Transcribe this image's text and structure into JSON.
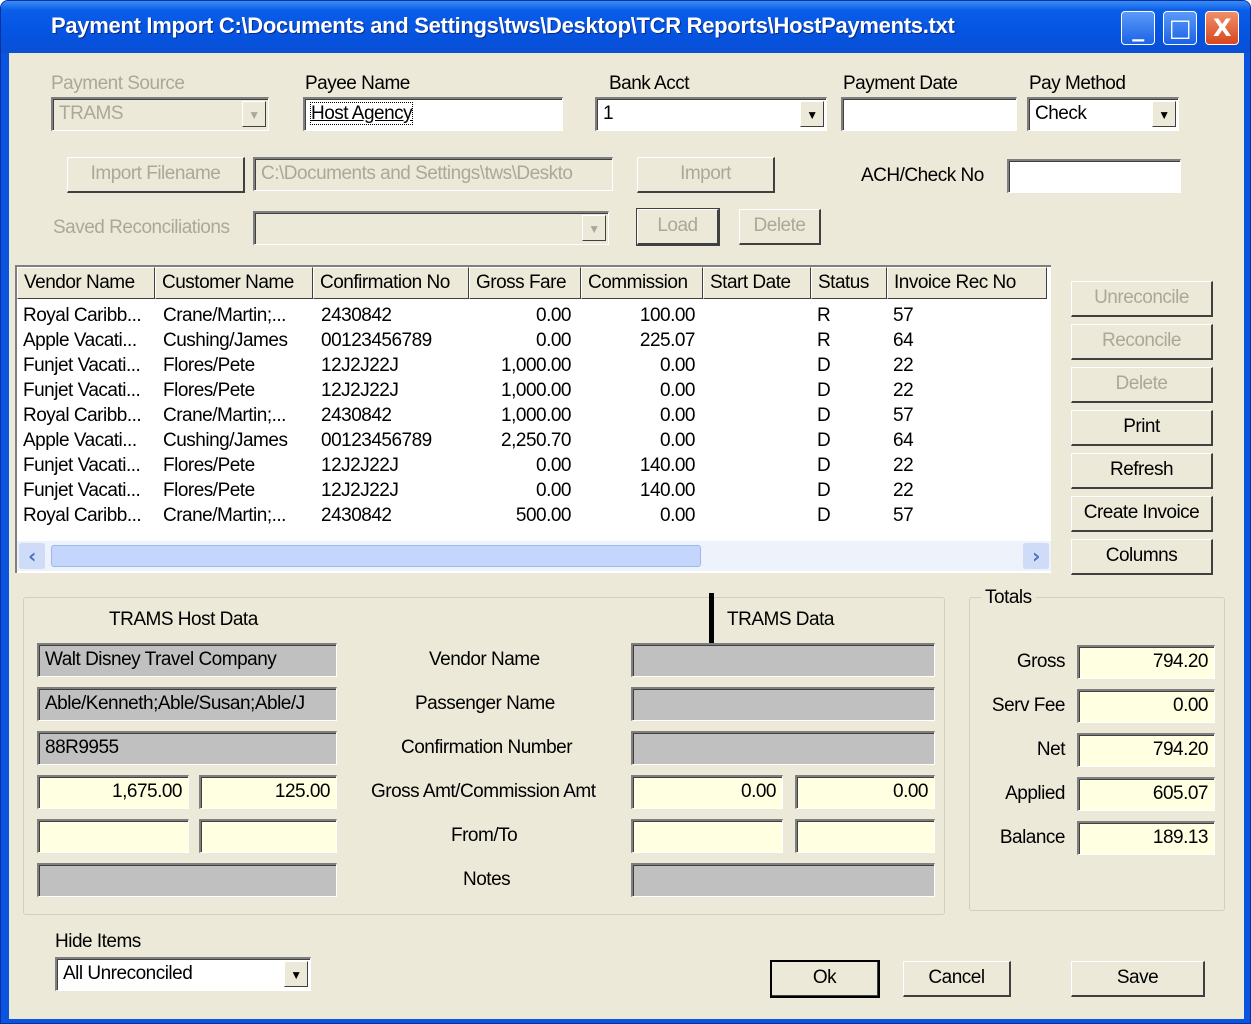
{
  "window": {
    "title": "Payment Import C:\\Documents and Settings\\tws\\Desktop\\TCR Reports\\HostPayments.txt",
    "controls": [
      "_",
      "□",
      "X"
    ]
  },
  "form": {
    "payment_source": {
      "label": "Payment Source",
      "value": "TRAMS"
    },
    "payee_name": {
      "label": "Payee Name",
      "value": "Host Agency"
    },
    "bank_acct": {
      "label": "Bank Acct",
      "value": "1"
    },
    "payment_date": {
      "label": "Payment Date",
      "value": ""
    },
    "pay_method": {
      "label": "Pay Method",
      "value": "Check"
    },
    "import_filename_button": "Import Filename",
    "import_filename_value": "C:\\Documents and Settings\\tws\\Deskto",
    "import_button": "Import",
    "ach_check_no": {
      "label": "ACH/Check No",
      "value": ""
    },
    "saved_reconciliations": {
      "label": "Saved Reconciliations",
      "value": ""
    },
    "load_button": "Load",
    "delete_button": "Delete"
  },
  "grid": {
    "columns": [
      "Vendor Name",
      "Customer Name",
      "Confirmation No",
      "Gross Fare",
      "Commission",
      "Start Date",
      "Status",
      "Invoice Rec No"
    ],
    "rows": [
      [
        "Royal Caribb...",
        "Crane/Martin;...",
        "2430842",
        "0.00",
        "100.00",
        "",
        "R",
        "57"
      ],
      [
        "Apple Vacati...",
        "Cushing/James",
        "00123456789",
        "0.00",
        "225.07",
        "",
        "R",
        "64"
      ],
      [
        "Funjet Vacati...",
        "Flores/Pete",
        "12J2J22J",
        "1,000.00",
        "0.00",
        "",
        "D",
        "22"
      ],
      [
        "Funjet Vacati...",
        "Flores/Pete",
        "12J2J22J",
        "1,000.00",
        "0.00",
        "",
        "D",
        "22"
      ],
      [
        "Royal Caribb...",
        "Crane/Martin;...",
        "2430842",
        "1,000.00",
        "0.00",
        "",
        "D",
        "57"
      ],
      [
        "Apple Vacati...",
        "Cushing/James",
        "00123456789",
        "2,250.70",
        "0.00",
        "",
        "D",
        "64"
      ],
      [
        "Funjet Vacati...",
        "Flores/Pete",
        "12J2J22J",
        "0.00",
        "140.00",
        "",
        "D",
        "22"
      ],
      [
        "Funjet Vacati...",
        "Flores/Pete",
        "12J2J22J",
        "0.00",
        "140.00",
        "",
        "D",
        "22"
      ],
      [
        "Royal Caribb...",
        "Crane/Martin;...",
        "2430842",
        "500.00",
        "0.00",
        "",
        "D",
        "57"
      ]
    ]
  },
  "side_buttons": {
    "unreconcile": "Unreconcile",
    "reconcile": "Reconcile",
    "delete": "Delete",
    "print": "Print",
    "refresh": "Refresh",
    "create_invoice": "Create Invoice",
    "columns": "Columns"
  },
  "details": {
    "host_header": "TRAMS Host Data",
    "trams_header": "TRAMS Data",
    "labels": [
      "Vendor Name",
      "Passenger Name",
      "Confirmation Number",
      "Gross Amt/Commission Amt",
      "From/To",
      "Notes"
    ],
    "host_vendor": "Walt Disney Travel Company",
    "host_passenger": "Able/Kenneth;Able/Susan;Able/J",
    "host_confirmation": "88R9955",
    "host_gross": "1,675.00",
    "host_commission": "125.00",
    "trams_gross": "0.00",
    "trams_commission": "0.00"
  },
  "totals": {
    "title": "Totals",
    "gross": {
      "label": "Gross",
      "value": "794.20"
    },
    "serv_fee": {
      "label": "Serv Fee",
      "value": "0.00"
    },
    "net": {
      "label": "Net",
      "value": "794.20"
    },
    "applied": {
      "label": "Applied",
      "value": "605.07"
    },
    "balance": {
      "label": "Balance",
      "value": "189.13"
    }
  },
  "footer": {
    "hide_items_label": "Hide Items",
    "hide_items_value": "All Unreconciled",
    "ok": "Ok",
    "cancel": "Cancel",
    "save": "Save"
  }
}
